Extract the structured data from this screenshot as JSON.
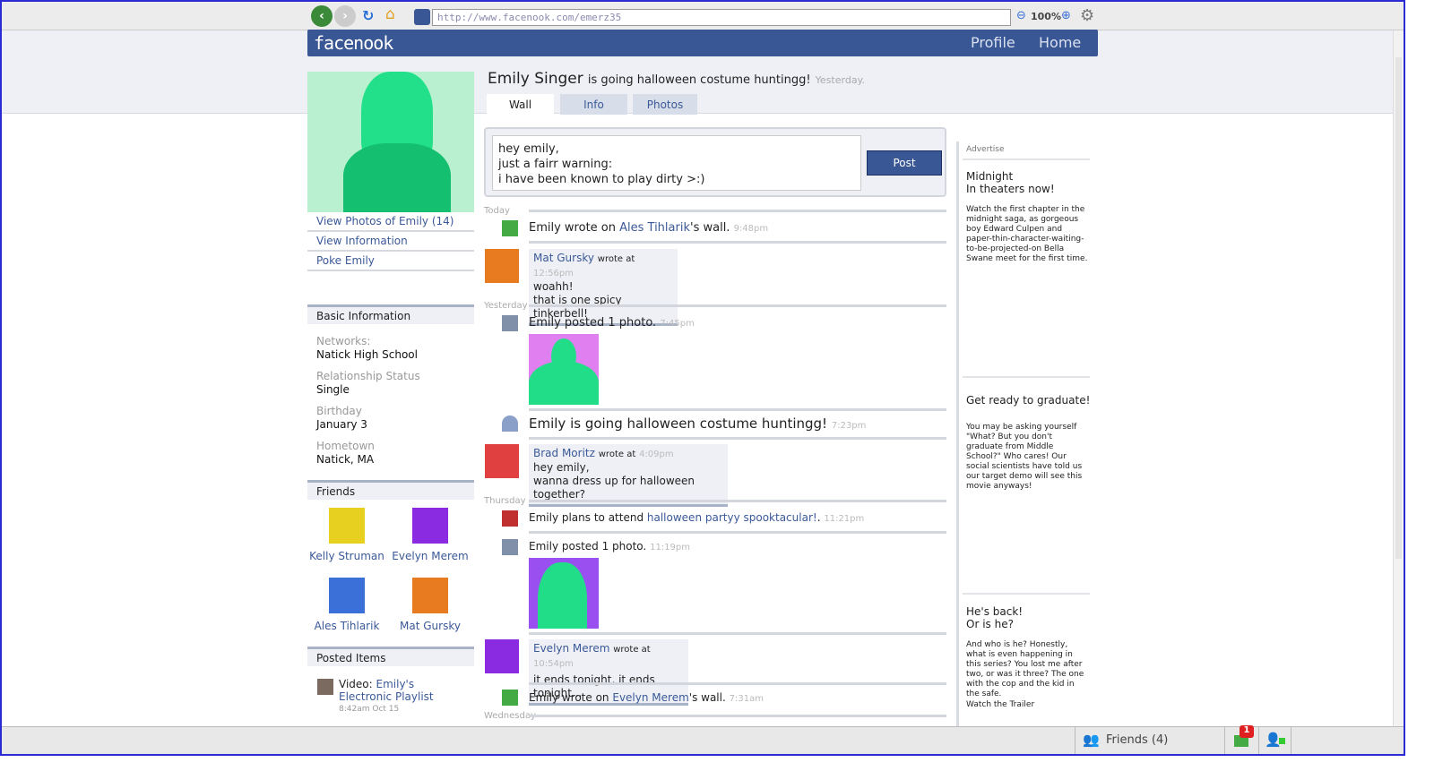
{
  "browser": {
    "url": "http://www.facenook.com/emerz35",
    "zoom": "100%"
  },
  "header": {
    "logo": "facenook",
    "nav": [
      "Profile",
      "Home"
    ]
  },
  "profile": {
    "name": "Emily Singer",
    "status": "is going halloween costume huntingg!",
    "status_time": "Yesterday.",
    "tabs": [
      "Wall",
      "Info",
      "Photos"
    ]
  },
  "left": {
    "links": [
      "View Photos of Emily (14)",
      "View Information",
      "Poke Emily"
    ],
    "basic_title": "Basic Information",
    "info": [
      {
        "label": "Networks:",
        "value": "Natick High School"
      },
      {
        "label": "Relationship Status",
        "value": "Single"
      },
      {
        "label": "Birthday",
        "value": "January 3"
      },
      {
        "label": "Hometown",
        "value": "Natick, MA"
      }
    ],
    "friends_title": "Friends",
    "friends": [
      {
        "name": "Kelly Struman",
        "color": "#e8d020"
      },
      {
        "name": "Evelyn Merem",
        "color": "#8a2be2"
      },
      {
        "name": "Ales Tihlarik",
        "color": "#3a70d8"
      },
      {
        "name": "Mat Gursky",
        "color": "#e87a20"
      }
    ],
    "posted_title": "Posted Items",
    "posted": {
      "prefix": "Video:",
      "title": "Emily's Electronic Playlist",
      "time": "8:42am Oct 15"
    }
  },
  "composer": {
    "text": "hey emily,\njust a fairr warning:\ni have been known to play dirty >:)",
    "post_label": "Post"
  },
  "feed": {
    "days": [
      "Today",
      "Yesterday",
      "Thursday",
      "Wednesday"
    ],
    "i1": {
      "a": "Emily wrote on ",
      "link": "Ales Tihlarik",
      "b": "'s wall.",
      "time": "9:48pm"
    },
    "i2": {
      "author": "Mat Gursky",
      "wrote": "wrote at",
      "time": "12:56pm",
      "lines": [
        "woahh!",
        "that is one spicy tinkerbell!"
      ]
    },
    "i3": {
      "text": "Emily posted 1 photo.",
      "time": "7:45pm"
    },
    "i4": {
      "text": "Emily is going halloween costume huntingg!",
      "time": "7:23pm"
    },
    "i5": {
      "author": "Brad Moritz",
      "wrote": "wrote at",
      "time": "4:09pm",
      "lines": [
        "hey emily,",
        "wanna dress up for halloween together?"
      ]
    },
    "i6": {
      "a": "Emily plans to attend ",
      "link": "halloween partyy spooktacular!",
      "b": ".",
      "time": "11:21pm"
    },
    "i7": {
      "text": "Emily posted 1 photo.",
      "time": "11:19pm"
    },
    "i8": {
      "author": "Evelyn Merem",
      "wrote": "wrote at",
      "time": "10:54pm",
      "lines": [
        "it ends tonight, it ends tonight..."
      ]
    },
    "i9": {
      "a": "Emily wrote on ",
      "link": "Evelyn Merem",
      "b": "'s wall.",
      "time": "7:31am"
    }
  },
  "ads": {
    "title": "Advertise",
    "items": [
      {
        "head": [
          "Midnight",
          "In theaters now!"
        ],
        "body": "Watch the first chapter in the midnight saga, as gorgeous boy Edward Culpen and paper-thin-character-waiting-to-be-projected-on Bella Swane meet for the first time."
      },
      {
        "head": [
          "Get ready to graduate!"
        ],
        "body": "You may be asking yourself \"What? But you don't graduate from Middle School?\" Who cares! Our social scientists have told us our target demo will see this movie anyways!"
      },
      {
        "head": [
          "He's back!",
          "Or is he?"
        ],
        "body": "And who is he? Honestly, what is even happening in this series? You lost me after two, or was it three? The one with the cop and the kid in the safe.",
        "link": "Watch the Trailer"
      }
    ]
  },
  "bottombar": {
    "friends": "Friends (4)",
    "notifications": "1"
  },
  "colors": {
    "brand": "#3a5795",
    "link": "#3b5998",
    "accent_green": "#22dd88"
  }
}
